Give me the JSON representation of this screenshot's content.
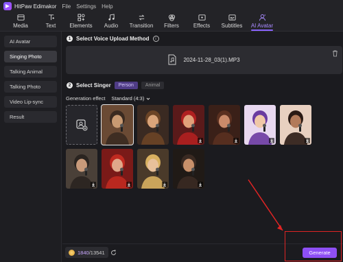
{
  "app": {
    "title": "HitPaw Edimakor",
    "menu": [
      "File",
      "Settings",
      "Help"
    ]
  },
  "toolbar": {
    "tabs": [
      {
        "label": "Media",
        "icon": "media-icon"
      },
      {
        "label": "Text",
        "icon": "text-icon"
      },
      {
        "label": "Elements",
        "icon": "elements-icon"
      },
      {
        "label": "Audio",
        "icon": "audio-icon"
      },
      {
        "label": "Transition",
        "icon": "transition-icon"
      },
      {
        "label": "Filters",
        "icon": "filters-icon"
      },
      {
        "label": "Effects",
        "icon": "effects-icon"
      },
      {
        "label": "Subtitles",
        "icon": "subtitles-icon"
      },
      {
        "label": "AI Avatar",
        "icon": "ai-avatar-icon",
        "active": true
      }
    ]
  },
  "sidebar": {
    "items": [
      {
        "label": "AI Avatar"
      },
      {
        "label": "Singing Photo",
        "active": true
      },
      {
        "label": "Talking Animal"
      },
      {
        "label": "Talking Photo"
      },
      {
        "label": "Video Lip-sync"
      },
      {
        "label": "Result"
      }
    ]
  },
  "step1": {
    "number": "1",
    "title": "Select Voice Upload Method",
    "info": "i",
    "file_name": "2024-11-28_03(1).MP3"
  },
  "step2": {
    "number": "2",
    "title": "Select Singer",
    "chips": [
      {
        "label": "Person",
        "active": true
      },
      {
        "label": "Animal",
        "active": false
      }
    ],
    "generation_label": "Generation effect",
    "generation_value": "Standard (4:3)"
  },
  "singers": [
    {
      "id": "singer-1",
      "palette": [
        "#6a4a34",
        "#c89a72",
        "#3a2a20"
      ],
      "selected": true,
      "download": false
    },
    {
      "id": "singer-2",
      "palette": [
        "#3a2a22",
        "#d9a47a",
        "#6b4426"
      ],
      "download": false
    },
    {
      "id": "singer-3",
      "palette": [
        "#5a1a1a",
        "#e0a07a",
        "#b02020"
      ],
      "download": true
    },
    {
      "id": "singer-4",
      "palette": [
        "#3a2018",
        "#c98a6a",
        "#5a3020"
      ],
      "download": true
    },
    {
      "id": "singer-5",
      "palette": [
        "#e8d8f0",
        "#f0c8a8",
        "#6a3aa0"
      ],
      "download": true
    },
    {
      "id": "singer-6",
      "palette": [
        "#e8d0c0",
        "#b27a5a",
        "#2a1a14"
      ],
      "download": true
    },
    {
      "id": "singer-7",
      "palette": [
        "#4a4038",
        "#c89a7a",
        "#2a2420"
      ],
      "download": true
    },
    {
      "id": "singer-8",
      "palette": [
        "#7a1a18",
        "#e0a88a",
        "#c02a20"
      ],
      "download": true
    },
    {
      "id": "singer-9",
      "palette": [
        "#4a3a2a",
        "#e8c09a",
        "#d8b060"
      ],
      "download": true
    },
    {
      "id": "singer-10",
      "palette": [
        "#201a16",
        "#c8906a",
        "#3a2a22"
      ],
      "download": true
    }
  ],
  "credits": {
    "used": "1840",
    "total": "/13541"
  },
  "generate_label": "Generate",
  "colors": {
    "accent": "#8e4ff5",
    "active_tab": "#a98bff",
    "highlight": "#e02424"
  }
}
